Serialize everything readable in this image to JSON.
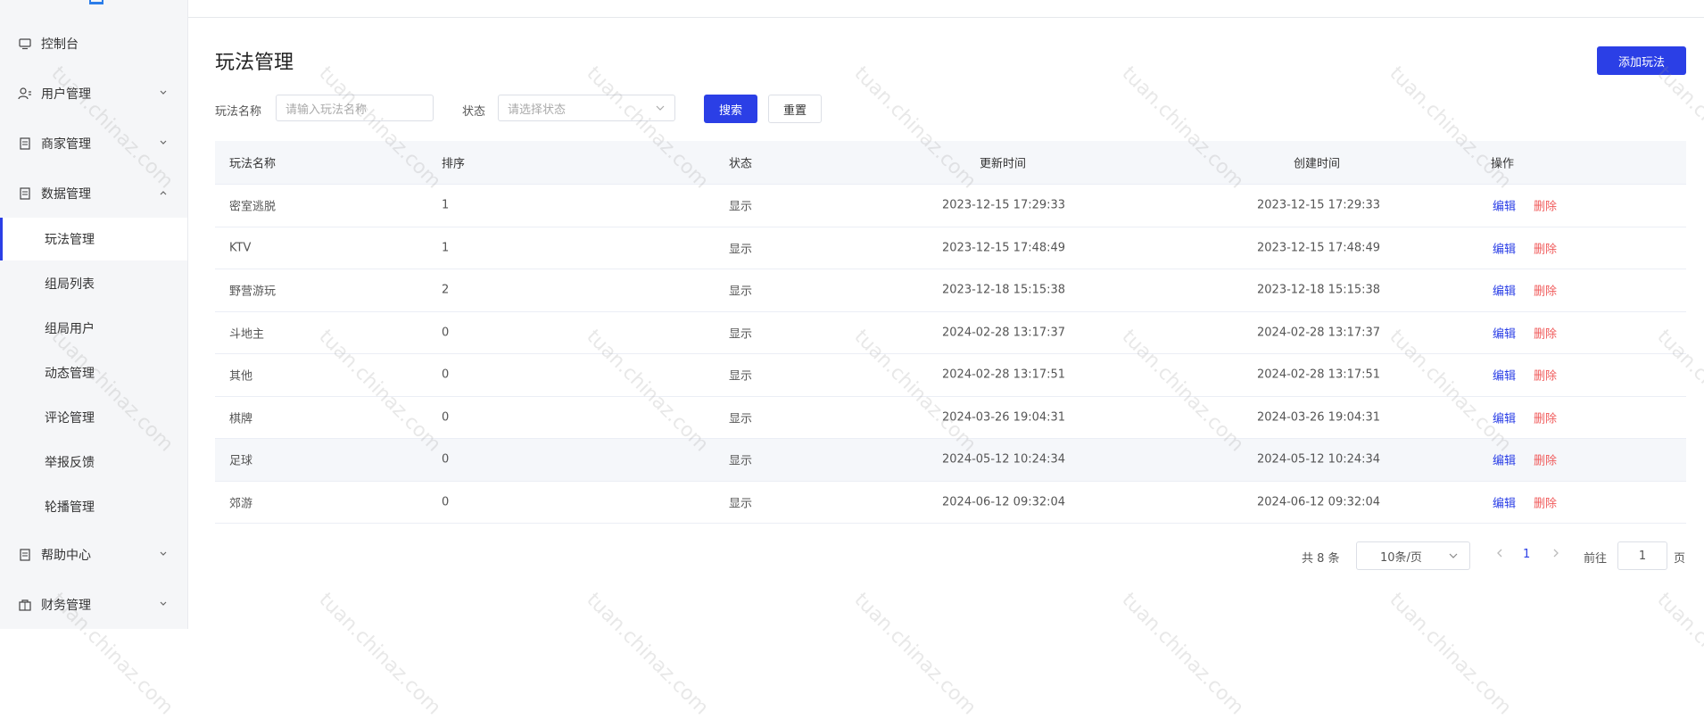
{
  "sidebar": {
    "items": [
      {
        "label": "控制台",
        "icon": "monitor-icon",
        "expandable": false
      },
      {
        "label": "用户管理",
        "icon": "user-icon",
        "expandable": true,
        "expanded": false
      },
      {
        "label": "商家管理",
        "icon": "document-icon",
        "expandable": true,
        "expanded": false
      },
      {
        "label": "数据管理",
        "icon": "document-icon",
        "expandable": true,
        "expanded": true
      },
      {
        "label": "帮助中心",
        "icon": "document-icon",
        "expandable": true,
        "expanded": false
      },
      {
        "label": "财务管理",
        "icon": "bag-icon",
        "expandable": true,
        "expanded": false
      }
    ],
    "sub_items": [
      {
        "label": "玩法管理",
        "active": true
      },
      {
        "label": "组局列表",
        "active": false
      },
      {
        "label": "组局用户",
        "active": false
      },
      {
        "label": "动态管理",
        "active": false
      },
      {
        "label": "评论管理",
        "active": false
      },
      {
        "label": "举报反馈",
        "active": false
      },
      {
        "label": "轮播管理",
        "active": false
      }
    ]
  },
  "page": {
    "title": "玩法管理",
    "add_button": "添加玩法"
  },
  "filters": {
    "name_label": "玩法名称",
    "name_placeholder": "请输入玩法名称",
    "status_label": "状态",
    "status_placeholder": "请选择状态",
    "search_button": "搜索",
    "reset_button": "重置"
  },
  "table": {
    "headers": [
      "玩法名称",
      "排序",
      "状态",
      "更新时间",
      "创建时间",
      "操作"
    ],
    "edit_label": "编辑",
    "delete_label": "删除",
    "rows": [
      {
        "name": "密室逃脱",
        "sort": "1",
        "status": "显示",
        "updated": "2023-12-15 17:29:33",
        "created": "2023-12-15 17:29:33"
      },
      {
        "name": "KTV",
        "sort": "1",
        "status": "显示",
        "updated": "2023-12-15 17:48:49",
        "created": "2023-12-15 17:48:49"
      },
      {
        "name": "野营游玩",
        "sort": "2",
        "status": "显示",
        "updated": "2023-12-18 15:15:38",
        "created": "2023-12-18 15:15:38"
      },
      {
        "name": "斗地主",
        "sort": "0",
        "status": "显示",
        "updated": "2024-02-28 13:17:37",
        "created": "2024-02-28 13:17:37"
      },
      {
        "name": "其他",
        "sort": "0",
        "status": "显示",
        "updated": "2024-02-28 13:17:51",
        "created": "2024-02-28 13:17:51"
      },
      {
        "name": "棋牌",
        "sort": "0",
        "status": "显示",
        "updated": "2024-03-26 19:04:31",
        "created": "2024-03-26 19:04:31"
      },
      {
        "name": "足球",
        "sort": "0",
        "status": "显示",
        "updated": "2024-05-12 10:24:34",
        "created": "2024-05-12 10:24:34"
      },
      {
        "name": "郊游",
        "sort": "0",
        "status": "显示",
        "updated": "2024-06-12 09:32:04",
        "created": "2024-06-12 09:32:04"
      }
    ]
  },
  "pagination": {
    "total": "共 8 条",
    "page_size": "10条/页",
    "current_page": "1",
    "goto_label": "前往",
    "goto_value": "1",
    "page_suffix": "页"
  },
  "watermark": {
    "text": "tuan.chinaz.com"
  },
  "colors": {
    "primary": "#2b3fe6",
    "danger": "#f05a5a",
    "sidebar_bg": "#f5f6f8"
  }
}
